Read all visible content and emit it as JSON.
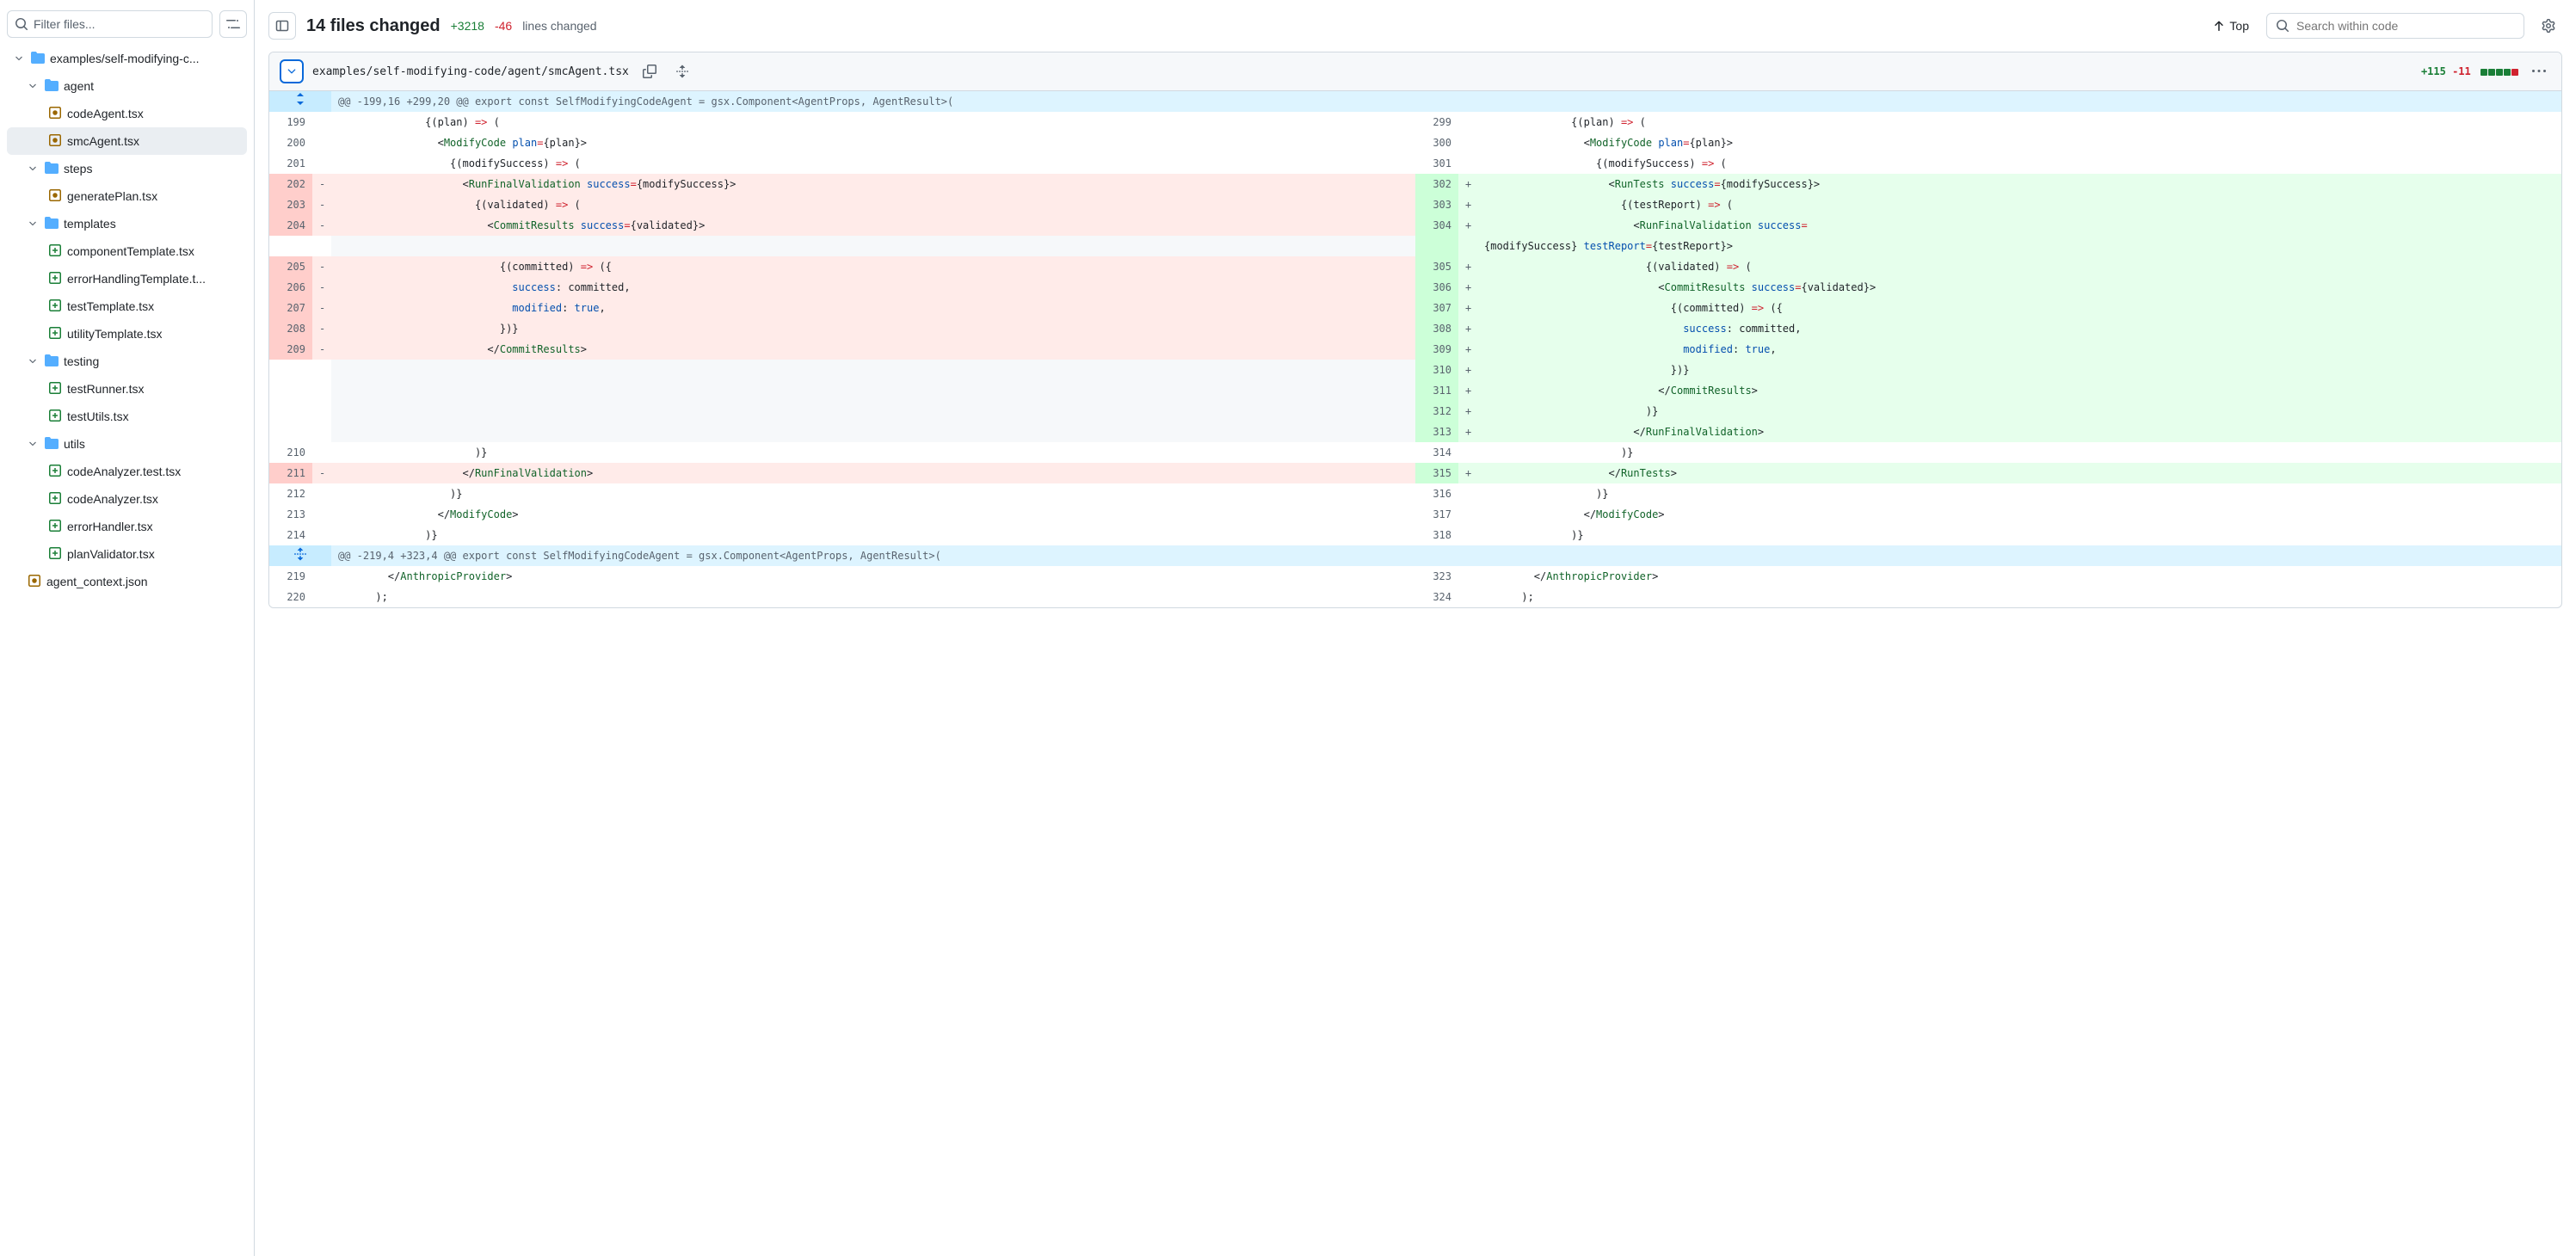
{
  "sidebar": {
    "filter_placeholder": "Filter files...",
    "tree": [
      {
        "type": "folder",
        "label": "examples/self-modifying-c...",
        "indent": 0,
        "expanded": true
      },
      {
        "type": "folder",
        "label": "agent",
        "indent": 1,
        "expanded": true
      },
      {
        "type": "file",
        "label": "codeAgent.tsx",
        "indent": 2,
        "status": "modified"
      },
      {
        "type": "file",
        "label": "smcAgent.tsx",
        "indent": 2,
        "status": "modified",
        "selected": true
      },
      {
        "type": "folder",
        "label": "steps",
        "indent": 1,
        "expanded": true
      },
      {
        "type": "file",
        "label": "generatePlan.tsx",
        "indent": 2,
        "status": "modified"
      },
      {
        "type": "folder",
        "label": "templates",
        "indent": 1,
        "expanded": true
      },
      {
        "type": "file",
        "label": "componentTemplate.tsx",
        "indent": 2,
        "status": "added"
      },
      {
        "type": "file",
        "label": "errorHandlingTemplate.t...",
        "indent": 2,
        "status": "added"
      },
      {
        "type": "file",
        "label": "testTemplate.tsx",
        "indent": 2,
        "status": "added"
      },
      {
        "type": "file",
        "label": "utilityTemplate.tsx",
        "indent": 2,
        "status": "added"
      },
      {
        "type": "folder",
        "label": "testing",
        "indent": 1,
        "expanded": true
      },
      {
        "type": "file",
        "label": "testRunner.tsx",
        "indent": 2,
        "status": "added"
      },
      {
        "type": "file",
        "label": "testUtils.tsx",
        "indent": 2,
        "status": "added"
      },
      {
        "type": "folder",
        "label": "utils",
        "indent": 1,
        "expanded": true
      },
      {
        "type": "file",
        "label": "codeAnalyzer.test.tsx",
        "indent": 2,
        "status": "added"
      },
      {
        "type": "file",
        "label": "codeAnalyzer.tsx",
        "indent": 2,
        "status": "added"
      },
      {
        "type": "file",
        "label": "errorHandler.tsx",
        "indent": 2,
        "status": "added"
      },
      {
        "type": "file",
        "label": "planValidator.tsx",
        "indent": 2,
        "status": "added"
      },
      {
        "type": "file",
        "label": "agent_context.json",
        "indent": 0,
        "status": "modified"
      }
    ]
  },
  "toolbar": {
    "title": "14 files changed",
    "additions": "+3218",
    "deletions": "-46",
    "lines_changed": "lines changed",
    "top_label": "Top",
    "search_placeholder": "Search within code"
  },
  "file": {
    "path": "examples/self-modifying-code/agent/smcAgent.tsx",
    "additions": "+115",
    "deletions": "-11",
    "squares": [
      "add",
      "add",
      "add",
      "add",
      "del"
    ]
  },
  "hunk1": "@@ -199,16 +299,20 @@ export const SelfModifyingCodeAgent = gsx.Component<AgentProps, AgentResult>(",
  "hunk2": "@@ -219,4 +323,4 @@ export const SelfModifyingCodeAgent = gsx.Component<AgentProps, AgentResult>(",
  "diff": {
    "left": [
      {
        "ln": "199",
        "t": "ctx",
        "code": [
          {
            "c": "s-plain",
            "t": "              {(plan) "
          },
          {
            "c": "s-kw",
            "t": "=>"
          },
          {
            "c": "s-plain",
            "t": " ("
          }
        ]
      },
      {
        "ln": "200",
        "t": "ctx",
        "code": [
          {
            "c": "s-plain",
            "t": "                <"
          },
          {
            "c": "s-tag",
            "t": "ModifyCode"
          },
          {
            "c": "s-plain",
            "t": " "
          },
          {
            "c": "s-attr",
            "t": "plan"
          },
          {
            "c": "s-kw",
            "t": "="
          },
          {
            "c": "s-plain",
            "t": "{plan}>"
          }
        ]
      },
      {
        "ln": "201",
        "t": "ctx",
        "code": [
          {
            "c": "s-plain",
            "t": "                  {(modifySuccess) "
          },
          {
            "c": "s-kw",
            "t": "=>"
          },
          {
            "c": "s-plain",
            "t": " ("
          }
        ]
      },
      {
        "ln": "202",
        "t": "del",
        "code": [
          {
            "c": "s-plain",
            "t": "                    <"
          },
          {
            "c": "s-tag",
            "t": "RunFinalValidation"
          },
          {
            "c": "s-plain",
            "t": " "
          },
          {
            "c": "s-attr",
            "t": "success"
          },
          {
            "c": "s-kw",
            "t": "="
          },
          {
            "c": "s-plain",
            "t": "{modifySuccess}>"
          }
        ]
      },
      {
        "ln": "203",
        "t": "del",
        "code": [
          {
            "c": "s-plain",
            "t": "                      {(validated) "
          },
          {
            "c": "s-kw",
            "t": "=>"
          },
          {
            "c": "s-plain",
            "t": " ("
          }
        ]
      },
      {
        "ln": "204",
        "t": "del",
        "code": [
          {
            "c": "s-plain",
            "t": "                        <"
          },
          {
            "c": "s-tag",
            "t": "CommitResults"
          },
          {
            "c": "s-plain",
            "t": " "
          },
          {
            "c": "s-attr",
            "t": "success"
          },
          {
            "c": "s-kw",
            "t": "="
          },
          {
            "c": "s-plain",
            "t": "{validated}>"
          }
        ]
      },
      {
        "ln": "",
        "t": "empty"
      },
      {
        "ln": "205",
        "t": "del",
        "code": [
          {
            "c": "s-plain",
            "t": "                          {(committed) "
          },
          {
            "c": "s-kw",
            "t": "=>"
          },
          {
            "c": "s-plain",
            "t": " ({"
          }
        ]
      },
      {
        "ln": "206",
        "t": "del",
        "code": [
          {
            "c": "s-plain",
            "t": "                            "
          },
          {
            "c": "s-prop",
            "t": "success"
          },
          {
            "c": "s-plain",
            "t": ": committed,"
          }
        ]
      },
      {
        "ln": "207",
        "t": "del",
        "code": [
          {
            "c": "s-plain",
            "t": "                            "
          },
          {
            "c": "s-prop",
            "t": "modified"
          },
          {
            "c": "s-plain",
            "t": ": "
          },
          {
            "c": "s-val",
            "t": "true"
          },
          {
            "c": "s-plain",
            "t": ","
          }
        ]
      },
      {
        "ln": "208",
        "t": "del",
        "code": [
          {
            "c": "s-plain",
            "t": "                          })}"
          }
        ]
      },
      {
        "ln": "209",
        "t": "del",
        "code": [
          {
            "c": "s-plain",
            "t": "                        </"
          },
          {
            "c": "s-tag",
            "t": "CommitResults"
          },
          {
            "c": "s-plain",
            "t": ">"
          }
        ]
      },
      {
        "ln": "",
        "t": "empty"
      },
      {
        "ln": "",
        "t": "empty"
      },
      {
        "ln": "",
        "t": "empty"
      },
      {
        "ln": "",
        "t": "empty"
      },
      {
        "ln": "210",
        "t": "ctx",
        "code": [
          {
            "c": "s-plain",
            "t": "                      )}"
          }
        ]
      },
      {
        "ln": "211",
        "t": "del",
        "code": [
          {
            "c": "s-plain",
            "t": "                    </"
          },
          {
            "c": "s-tag",
            "t": "RunFinalValidation"
          },
          {
            "c": "s-plain",
            "t": ">"
          }
        ]
      },
      {
        "ln": "212",
        "t": "ctx",
        "code": [
          {
            "c": "s-plain",
            "t": "                  )}"
          }
        ]
      },
      {
        "ln": "213",
        "t": "ctx",
        "code": [
          {
            "c": "s-plain",
            "t": "                </"
          },
          {
            "c": "s-tag",
            "t": "ModifyCode"
          },
          {
            "c": "s-plain",
            "t": ">"
          }
        ]
      },
      {
        "ln": "214",
        "t": "ctx",
        "code": [
          {
            "c": "s-plain",
            "t": "              )}"
          }
        ]
      }
    ],
    "right": [
      {
        "ln": "299",
        "t": "ctx",
        "code": [
          {
            "c": "s-plain",
            "t": "              {(plan) "
          },
          {
            "c": "s-kw",
            "t": "=>"
          },
          {
            "c": "s-plain",
            "t": " ("
          }
        ]
      },
      {
        "ln": "300",
        "t": "ctx",
        "code": [
          {
            "c": "s-plain",
            "t": "                <"
          },
          {
            "c": "s-tag",
            "t": "ModifyCode"
          },
          {
            "c": "s-plain",
            "t": " "
          },
          {
            "c": "s-attr",
            "t": "plan"
          },
          {
            "c": "s-kw",
            "t": "="
          },
          {
            "c": "s-plain",
            "t": "{plan}>"
          }
        ]
      },
      {
        "ln": "301",
        "t": "ctx",
        "code": [
          {
            "c": "s-plain",
            "t": "                  {(modifySuccess) "
          },
          {
            "c": "s-kw",
            "t": "=>"
          },
          {
            "c": "s-plain",
            "t": " ("
          }
        ]
      },
      {
        "ln": "302",
        "t": "add",
        "code": [
          {
            "c": "s-plain",
            "t": "                    <"
          },
          {
            "c": "s-tag",
            "t": "RunTests"
          },
          {
            "c": "s-plain",
            "t": " "
          },
          {
            "c": "s-attr",
            "t": "success"
          },
          {
            "c": "s-kw",
            "t": "="
          },
          {
            "c": "s-plain",
            "t": "{modifySuccess}>"
          }
        ]
      },
      {
        "ln": "303",
        "t": "add",
        "code": [
          {
            "c": "s-plain",
            "t": "                      {(testReport) "
          },
          {
            "c": "s-kw",
            "t": "=>"
          },
          {
            "c": "s-plain",
            "t": " ("
          }
        ]
      },
      {
        "ln": "304",
        "t": "add",
        "code": [
          {
            "c": "s-plain",
            "t": "                        <"
          },
          {
            "c": "s-tag",
            "t": "RunFinalValidation"
          },
          {
            "c": "s-plain",
            "t": " "
          },
          {
            "c": "s-attr",
            "t": "success"
          },
          {
            "c": "s-kw",
            "t": "="
          }
        ]
      },
      {
        "ln": "",
        "t": "add-cont",
        "code": [
          {
            "c": "s-plain",
            "t": "{modifySuccess} "
          },
          {
            "c": "s-attr",
            "t": "testReport"
          },
          {
            "c": "s-kw",
            "t": "="
          },
          {
            "c": "s-plain",
            "t": "{testReport}>"
          }
        ]
      },
      {
        "ln": "305",
        "t": "add",
        "code": [
          {
            "c": "s-plain",
            "t": "                          {(validated) "
          },
          {
            "c": "s-kw",
            "t": "=>"
          },
          {
            "c": "s-plain",
            "t": " ("
          }
        ]
      },
      {
        "ln": "306",
        "t": "add",
        "code": [
          {
            "c": "s-plain",
            "t": "                            <"
          },
          {
            "c": "s-tag",
            "t": "CommitResults"
          },
          {
            "c": "s-plain",
            "t": " "
          },
          {
            "c": "s-attr",
            "t": "success"
          },
          {
            "c": "s-kw",
            "t": "="
          },
          {
            "c": "s-plain",
            "t": "{validated}>"
          }
        ]
      },
      {
        "ln": "307",
        "t": "add",
        "code": [
          {
            "c": "s-plain",
            "t": "                              {(committed) "
          },
          {
            "c": "s-kw",
            "t": "=>"
          },
          {
            "c": "s-plain",
            "t": " ({"
          }
        ]
      },
      {
        "ln": "308",
        "t": "add",
        "code": [
          {
            "c": "s-plain",
            "t": "                                "
          },
          {
            "c": "s-prop",
            "t": "success"
          },
          {
            "c": "s-plain",
            "t": ": committed,"
          }
        ]
      },
      {
        "ln": "309",
        "t": "add",
        "code": [
          {
            "c": "s-plain",
            "t": "                                "
          },
          {
            "c": "s-prop",
            "t": "modified"
          },
          {
            "c": "s-plain",
            "t": ": "
          },
          {
            "c": "s-val",
            "t": "true"
          },
          {
            "c": "s-plain",
            "t": ","
          }
        ]
      },
      {
        "ln": "310",
        "t": "add",
        "code": [
          {
            "c": "s-plain",
            "t": "                              })}"
          }
        ]
      },
      {
        "ln": "311",
        "t": "add",
        "code": [
          {
            "c": "s-plain",
            "t": "                            </"
          },
          {
            "c": "s-tag",
            "t": "CommitResults"
          },
          {
            "c": "s-plain",
            "t": ">"
          }
        ]
      },
      {
        "ln": "312",
        "t": "add",
        "code": [
          {
            "c": "s-plain",
            "t": "                          )}"
          }
        ]
      },
      {
        "ln": "313",
        "t": "add",
        "code": [
          {
            "c": "s-plain",
            "t": "                        </"
          },
          {
            "c": "s-tag",
            "t": "RunFinalValidation"
          },
          {
            "c": "s-plain",
            "t": ">"
          }
        ]
      },
      {
        "ln": "314",
        "t": "ctx",
        "code": [
          {
            "c": "s-plain",
            "t": "                      )}"
          }
        ]
      },
      {
        "ln": "315",
        "t": "add",
        "code": [
          {
            "c": "s-plain",
            "t": "                    </"
          },
          {
            "c": "s-tag",
            "t": "RunTests"
          },
          {
            "c": "s-plain",
            "t": ">"
          }
        ]
      },
      {
        "ln": "316",
        "t": "ctx",
        "code": [
          {
            "c": "s-plain",
            "t": "                  )}"
          }
        ]
      },
      {
        "ln": "317",
        "t": "ctx",
        "code": [
          {
            "c": "s-plain",
            "t": "                </"
          },
          {
            "c": "s-tag",
            "t": "ModifyCode"
          },
          {
            "c": "s-plain",
            "t": ">"
          }
        ]
      },
      {
        "ln": "318",
        "t": "ctx",
        "code": [
          {
            "c": "s-plain",
            "t": "              )}"
          }
        ]
      }
    ],
    "after_left": [
      {
        "ln": "219",
        "t": "ctx",
        "code": [
          {
            "c": "s-plain",
            "t": "        </"
          },
          {
            "c": "s-tag",
            "t": "AnthropicProvider"
          },
          {
            "c": "s-plain",
            "t": ">"
          }
        ]
      },
      {
        "ln": "220",
        "t": "ctx",
        "code": [
          {
            "c": "s-plain",
            "t": "      );"
          }
        ]
      }
    ],
    "after_right": [
      {
        "ln": "323",
        "t": "ctx",
        "code": [
          {
            "c": "s-plain",
            "t": "        </"
          },
          {
            "c": "s-tag",
            "t": "AnthropicProvider"
          },
          {
            "c": "s-plain",
            "t": ">"
          }
        ]
      },
      {
        "ln": "324",
        "t": "ctx",
        "code": [
          {
            "c": "s-plain",
            "t": "      );"
          }
        ]
      }
    ]
  }
}
